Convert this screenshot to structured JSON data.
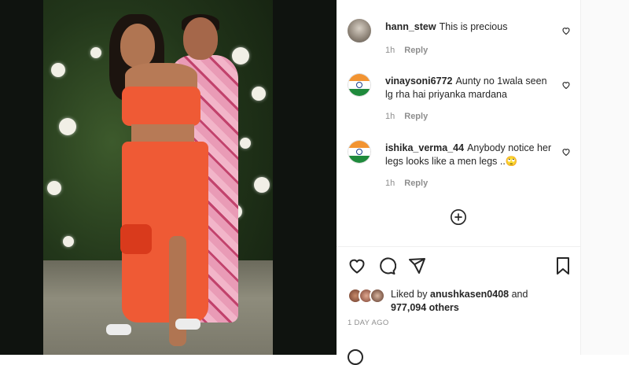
{
  "comments": [
    {
      "username": "hann_stew",
      "text": "This is precious",
      "time": "1h",
      "reply": "Reply"
    },
    {
      "username": "vinaysoni6772",
      "text": "Aunty no 1wala seen lg rha hai priyanka mardana",
      "time": "1h",
      "reply": "Reply"
    },
    {
      "username": "ishika_verma_44",
      "text": "Anybody notice her legs looks like a men legs ..🙄",
      "time": "1h",
      "reply": "Reply"
    }
  ],
  "likes": {
    "prefix": "Liked by",
    "user": "anushkasen0408",
    "and": "and",
    "others": "977,094 others"
  },
  "timestamp": "1 DAY AGO",
  "colors": {
    "text": "#262626",
    "muted": "#8e8e8e",
    "border": "#efefef",
    "dress": "#ef5a35"
  }
}
